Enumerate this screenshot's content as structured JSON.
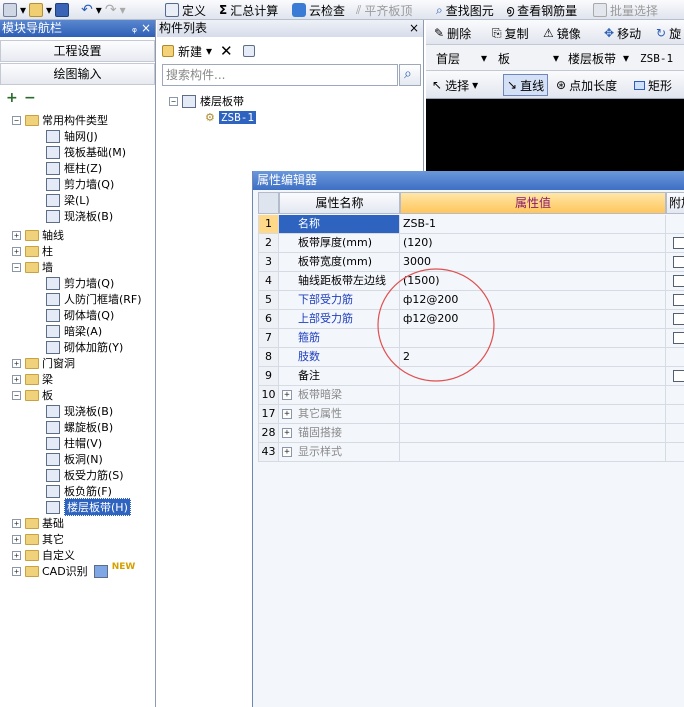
{
  "toolbar": {
    "items": [
      "定义",
      "汇总计算",
      "云检查",
      "平齐板顶",
      "查找图元",
      "查看钢筋量",
      "批量选择"
    ]
  },
  "nav": {
    "title": "模块导航栏",
    "pin": "ᵩ",
    "close": "×",
    "btn_project": "工程设置",
    "btn_draw": "绘图输入",
    "tree": {
      "common": "常用构件类型",
      "axis_grid": "轴网(J)",
      "raft": "筏板基础(M)",
      "frame_col": "框柱(Z)",
      "shear_wall": "剪力墙(Q)",
      "beam": "梁(L)",
      "cast_slab": "现浇板(B)",
      "axis": "轴线",
      "column": "柱",
      "wall": "墙",
      "w_shear": "剪力墙(Q)",
      "w_civil": "人防门框墙(RF)",
      "w_masonry": "砌体墙(Q)",
      "w_hidden_beam": "暗梁(A)",
      "w_masonry_rebar": "砌体加筋(Y)",
      "doors": "门窗洞",
      "beams": "梁",
      "slab": "板",
      "s_cast": "现浇板(B)",
      "s_spiral": "螺旋板(B)",
      "s_cap": "柱帽(V)",
      "s_hole": "板洞(N)",
      "s_rebar": "板受力筋(S)",
      "s_neg": "板负筋(F)",
      "s_band": "楼层板带(H)",
      "foundation": "基础",
      "other": "其它",
      "custom": "自定义",
      "cad": "CAD识别",
      "new_badge": "NEW"
    }
  },
  "complist": {
    "title": "构件列表",
    "close": "×",
    "new_label": "新建",
    "search_placeholder": "搜索构件...",
    "root": "楼层板带",
    "child": "ZSB-1"
  },
  "right": {
    "tb1": [
      "删除",
      "复制",
      "镜像",
      "移动",
      "旋"
    ],
    "tb2": [
      "首层",
      "板",
      "楼层板带",
      "ZSB-1"
    ],
    "tb3": [
      "选择",
      "直线",
      "点加长度",
      "矩形"
    ]
  },
  "editor": {
    "title": "属性编辑器",
    "col_name": "属性名称",
    "col_value": "属性值",
    "col_extra": "附加",
    "rows": [
      {
        "no": "1",
        "name": "名称",
        "value": "ZSB-1"
      },
      {
        "no": "2",
        "name": "板带厚度(mm)",
        "value": "(120)"
      },
      {
        "no": "3",
        "name": "板带宽度(mm)",
        "value": "3000"
      },
      {
        "no": "4",
        "name": "轴线距板带左边线",
        "value": "(1500)"
      },
      {
        "no": "5",
        "name": "下部受力筋",
        "value": "ф12@200"
      },
      {
        "no": "6",
        "name": "上部受力筋",
        "value": "ф12@200"
      },
      {
        "no": "7",
        "name": "箍筋",
        "value": ""
      },
      {
        "no": "8",
        "name": "肢数",
        "value": "2"
      },
      {
        "no": "9",
        "name": "备注",
        "value": ""
      },
      {
        "no": "10",
        "name": "板带暗梁",
        "value": ""
      },
      {
        "no": "17",
        "name": "其它属性",
        "value": ""
      },
      {
        "no": "28",
        "name": "锚固搭接",
        "value": ""
      },
      {
        "no": "43",
        "name": "显示样式",
        "value": ""
      }
    ]
  },
  "colors": {
    "accent": "#2f63c0",
    "blue_text": "#1f3fbf",
    "annotation": "#e05050"
  }
}
